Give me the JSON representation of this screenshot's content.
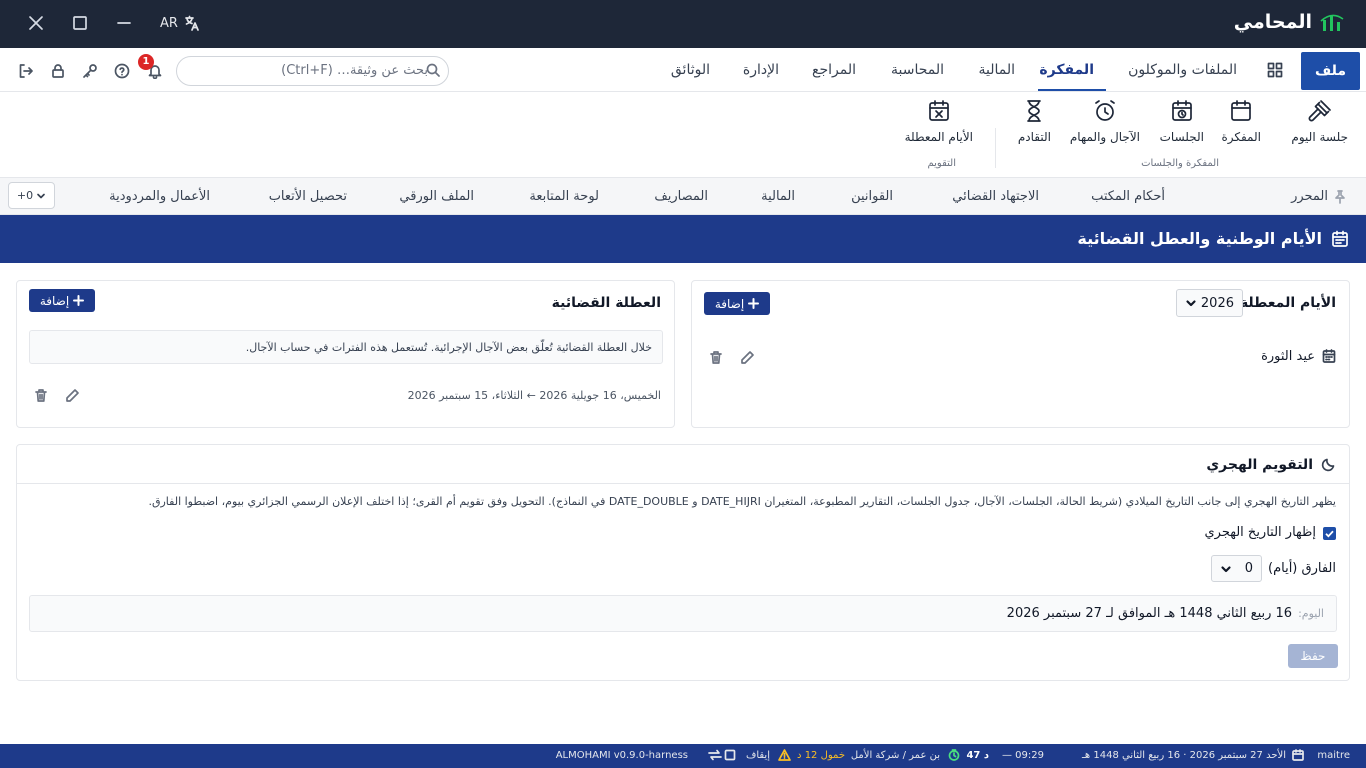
{
  "app": {
    "name": "المحامي",
    "lang": "AR"
  },
  "menu": {
    "file": "ملف",
    "items": [
      "الملفات والموكلون",
      "المفكرة",
      "المالية",
      "المحاسبة",
      "المراجع",
      "الإدارة",
      "الوثائق"
    ],
    "active": "المفكرة",
    "search_placeholder": "بحث عن وثيقة… (Ctrl+F)",
    "notifications_count": "1"
  },
  "ribbon": {
    "groups": [
      {
        "label": "المفكرة والجلسات",
        "buttons": [
          "جلسة اليوم",
          "المفكرة",
          "الجلسات",
          "الآجال والمهام",
          "التقادم"
        ]
      },
      {
        "label": "التقويم",
        "buttons": [
          "الأيام المعطلة"
        ]
      }
    ]
  },
  "tabs": [
    "المحرر",
    "أحكام المكتب",
    "الاجتهاد القضائي",
    "القوانين",
    "المالية",
    "المصاريف",
    "لوحة المتابعة",
    "الملف الورقي",
    "تحصيل الأتعاب",
    "الأعمال والمردودية"
  ],
  "more_tabs": "+0",
  "page_title": "الأيام الوطنية والعطل القضائية",
  "holidays": {
    "title": "الأيام المعطلة",
    "year": "2026",
    "add": "إضافة",
    "items": [
      {
        "name": "عيد الثورة"
      }
    ]
  },
  "judicial": {
    "title": "العطلة القضائية",
    "add": "إضافة",
    "note": "خلال العطلة القضائية تُعلّق بعض الآجال الإجرائية. تُستعمل هذه الفترات في حساب الآجال.",
    "period": "الخميس، 16 جويلية 2026 ← الثلاثاء، 15 سبتمبر 2026"
  },
  "hijri": {
    "title": "التقويم الهجري",
    "description": "يظهر التاريخ الهجري إلى جانب التاريخ الميلادي (شريط الحالة، الجلسات، الآجال، جدول الجلسات، التقارير المطبوعة، المتغيران DATE_HIJRI و DATE_DOUBLE في النماذج). التحويل وفق تقويم أم القرى؛ إذا اختلف الإعلان الرسمي الجزائري بيوم، اضبطوا الفارق.",
    "show_label": "إظهار التاريخ الهجري",
    "show_checked": true,
    "offset_label": "الفارق (أيام)",
    "offset_value": "0",
    "today_prefix": "اليوم:",
    "today_value": "16 ربيع الثاني 1448 هـ الموافق لـ 27 سبتمبر 2026",
    "save": "حفظ"
  },
  "statusbar": {
    "user": "maitre",
    "date": "الأحد 27 سبتمبر 2026 · 16 ربيع الثاني 1448 هـ",
    "time": "— 09:29",
    "timer": "47 د",
    "client": "بن عمر / شركة الأمل",
    "idle": "خمول 12 د",
    "pause": "إيقاف",
    "version": "ALMOHAMI v0.9.0-harness"
  }
}
